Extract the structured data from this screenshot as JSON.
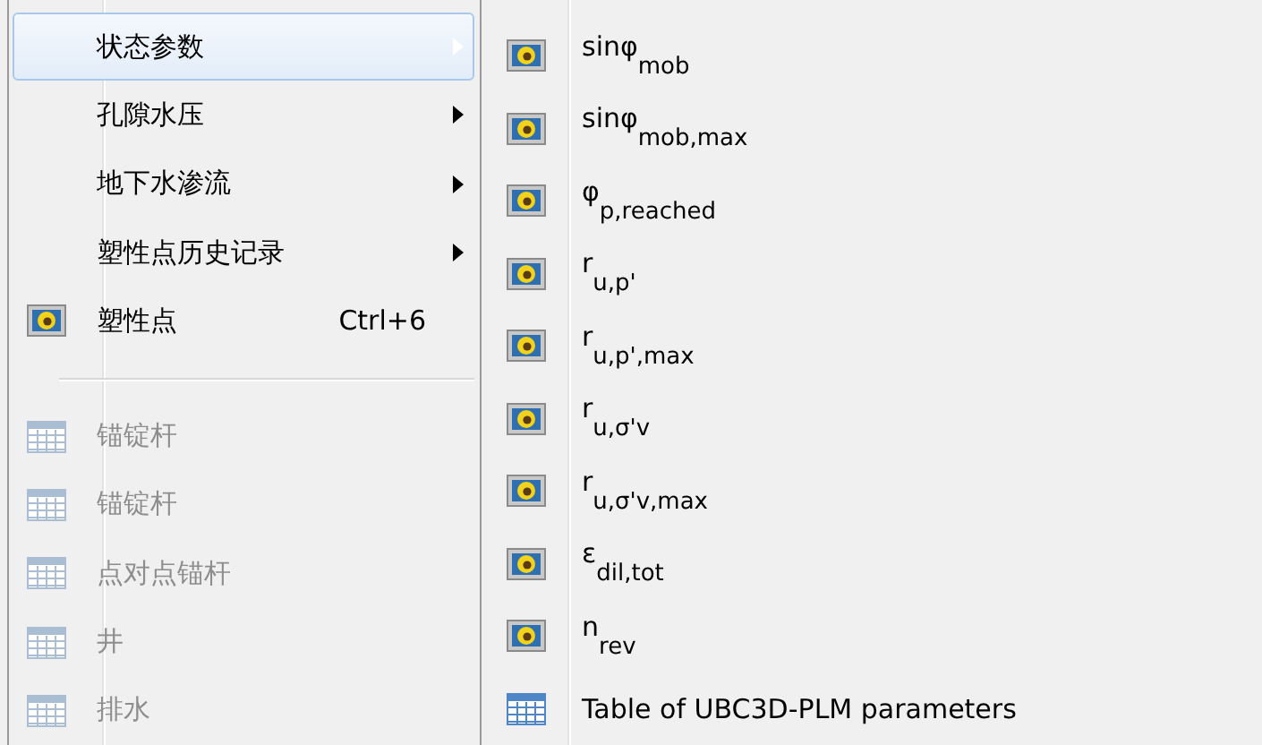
{
  "menu": {
    "items": [
      {
        "kind": "submenu",
        "label": "状态参数",
        "selected": true,
        "disabled": false
      },
      {
        "kind": "submenu",
        "label": "孔隙水压",
        "selected": false,
        "disabled": false
      },
      {
        "kind": "submenu",
        "label": "地下水渗流",
        "selected": false,
        "disabled": false
      },
      {
        "kind": "submenu",
        "label": "塑性点历史记录",
        "selected": false,
        "disabled": false
      },
      {
        "kind": "plot",
        "label": "塑性点",
        "shortcut": "Ctrl+6",
        "selected": false,
        "disabled": false
      },
      {
        "kind": "separator"
      },
      {
        "kind": "table",
        "label": "锚锭杆",
        "selected": false,
        "disabled": true
      },
      {
        "kind": "table",
        "label": "锚锭杆",
        "selected": false,
        "disabled": true
      },
      {
        "kind": "table",
        "label": "点对点锚杆",
        "selected": false,
        "disabled": true
      },
      {
        "kind": "table",
        "label": "井",
        "selected": false,
        "disabled": true
      },
      {
        "kind": "table",
        "label": "排水",
        "selected": false,
        "disabled": true
      }
    ]
  },
  "submenu": {
    "items": [
      {
        "kind": "plot",
        "label": "sinφ$_{mob}$"
      },
      {
        "kind": "plot",
        "label": "sinφ$_{mob,max}$"
      },
      {
        "kind": "plot",
        "label": "φ$_{p,reached}$"
      },
      {
        "kind": "plot",
        "label": "r$_{u,p'}$"
      },
      {
        "kind": "plot",
        "label": "r$_{u,p',max}$"
      },
      {
        "kind": "plot",
        "label": "r$_{u,σ'v}$"
      },
      {
        "kind": "plot",
        "label": "r$_{u,σ'v,max}$"
      },
      {
        "kind": "plot",
        "label": "ε$_{dil,tot}$"
      },
      {
        "kind": "plot",
        "label": "n$_{rev}$"
      },
      {
        "kind": "table",
        "label": "Table of UBC3D-PLM parameters"
      }
    ]
  }
}
